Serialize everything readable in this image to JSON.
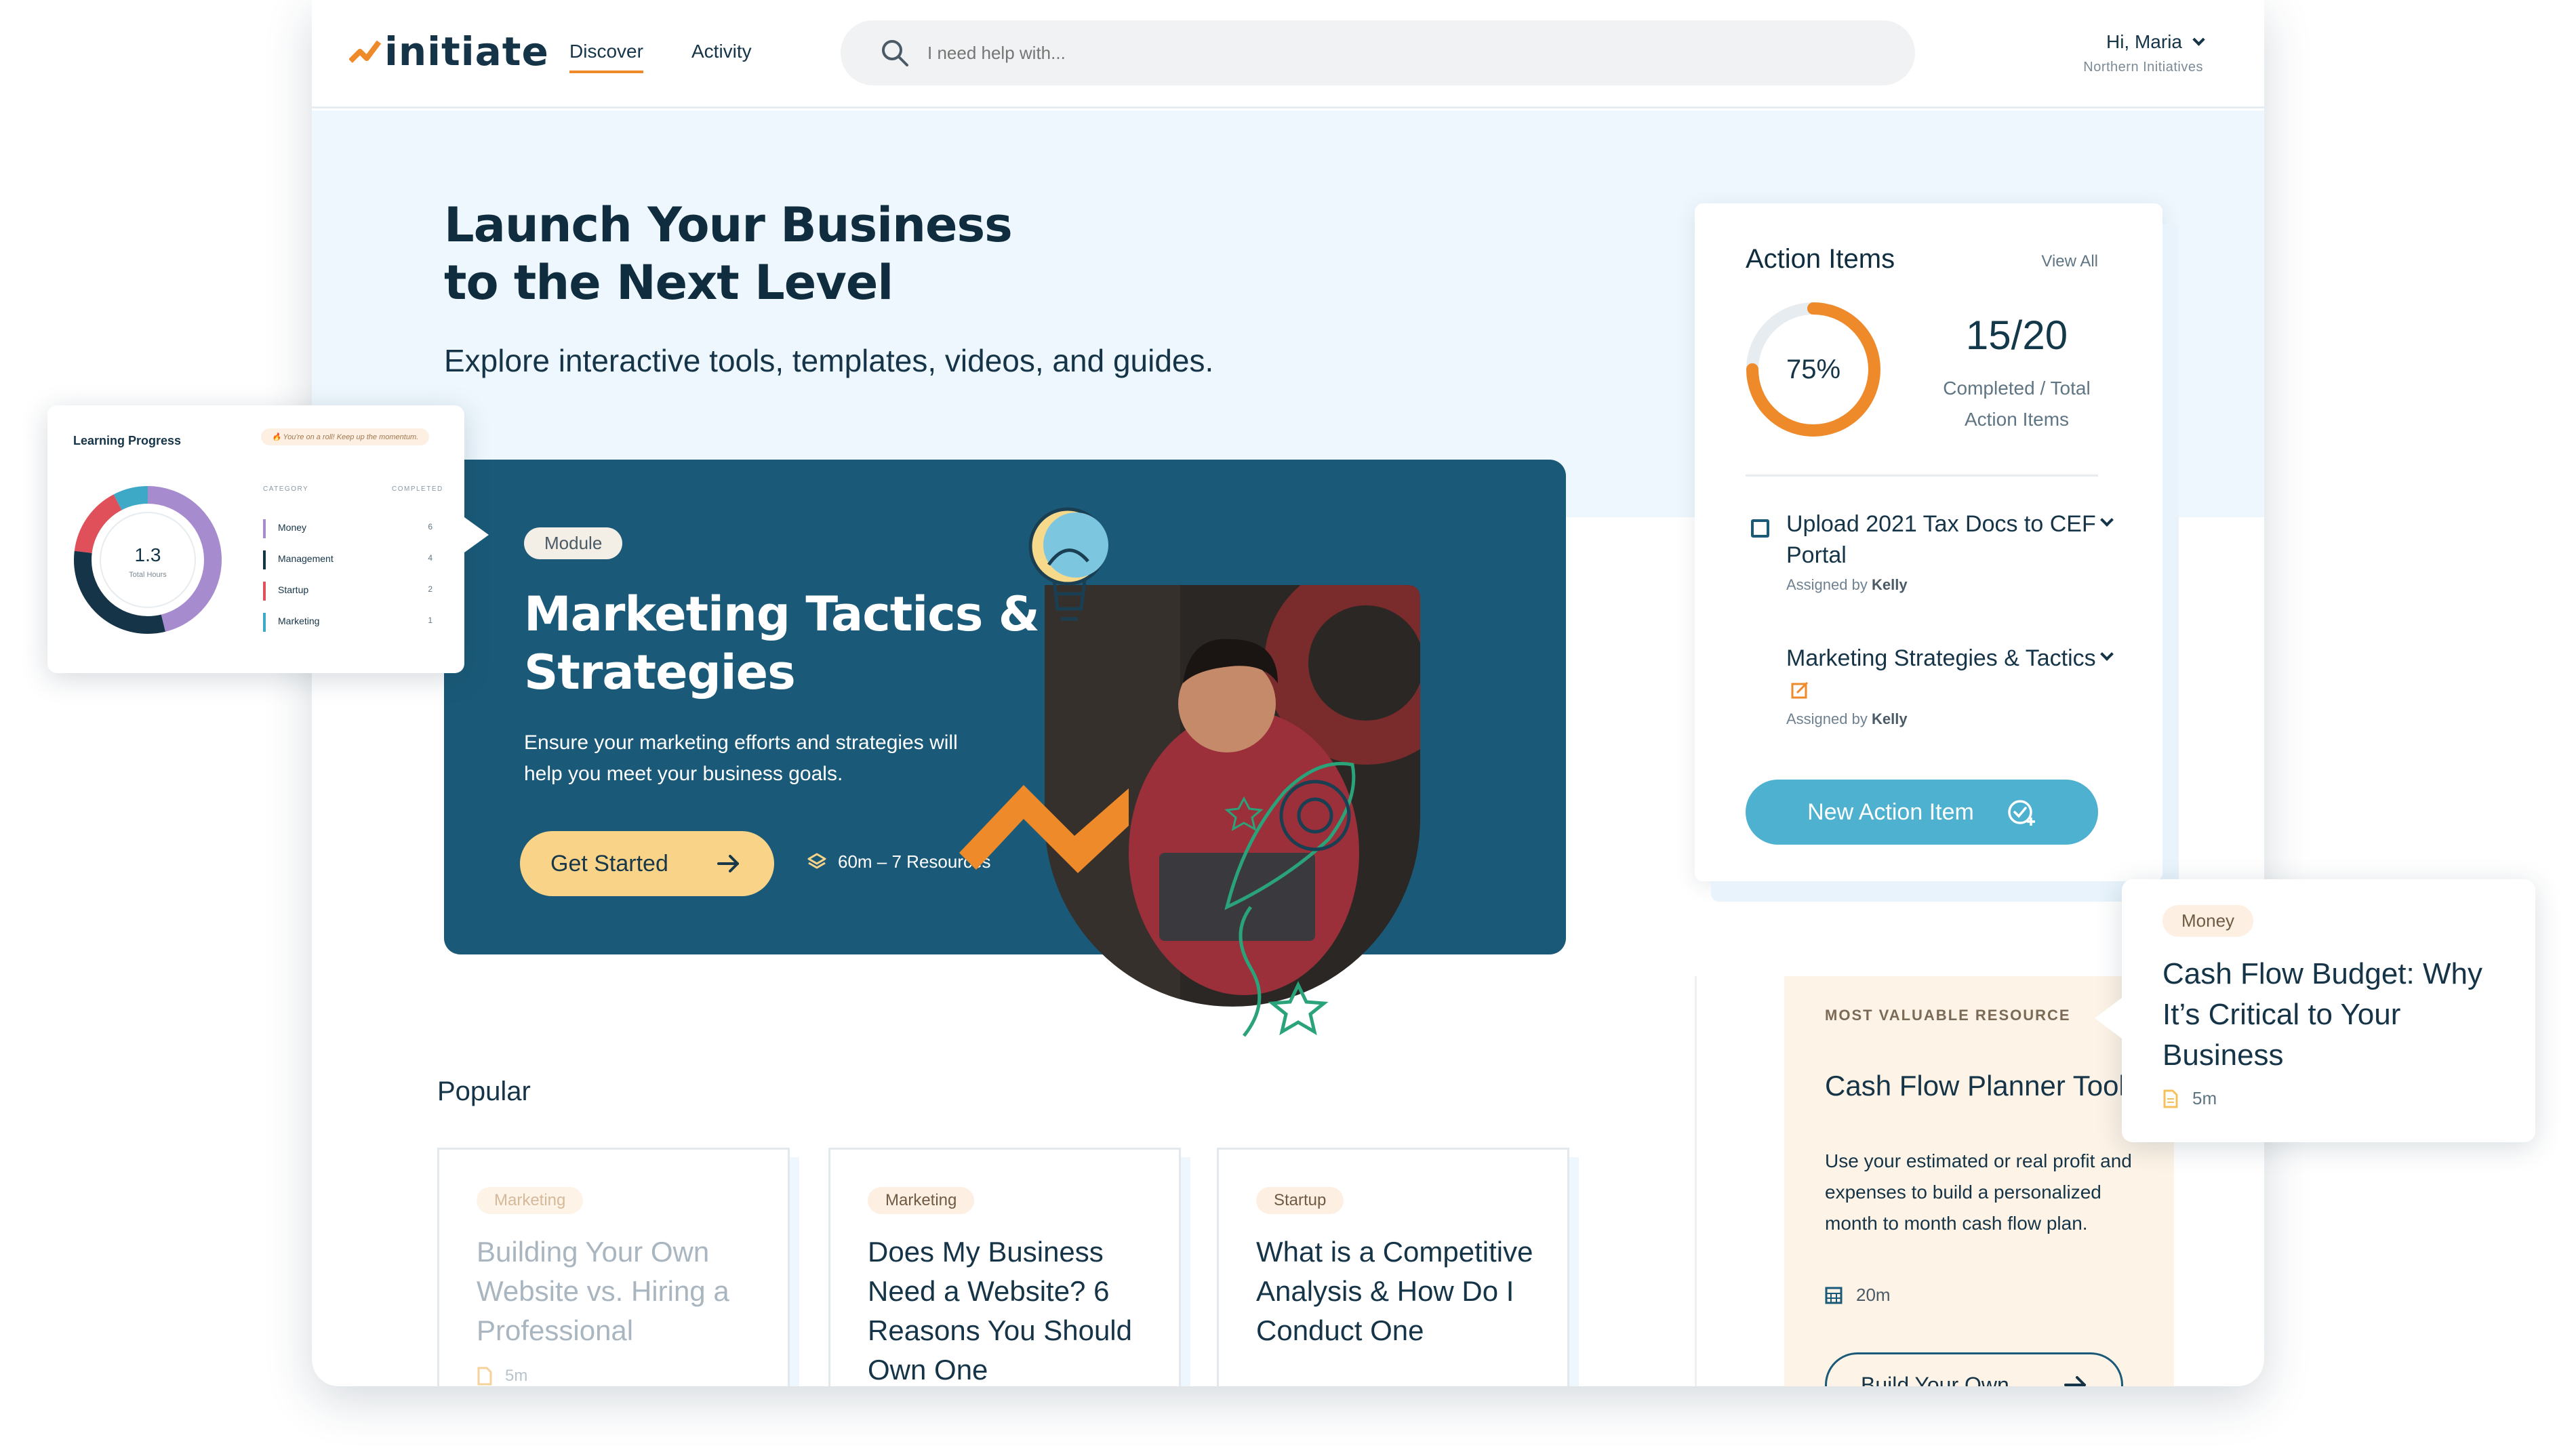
{
  "header": {
    "logo_text": "initiate",
    "nav": [
      "Discover",
      "Activity"
    ],
    "search_placeholder": "I need help with...",
    "user_greeting": "Hi, Maria",
    "user_org": "Northern Initiatives"
  },
  "hero": {
    "headline": "Launch Your Business to the Next Level",
    "subhead": "Explore interactive tools, templates, videos, and guides."
  },
  "module": {
    "badge": "Module",
    "title": "Marketing Tactics & Strategies",
    "description": "Ensure your marketing efforts and strategies will help you meet your business goals.",
    "cta": "Get Started",
    "meta": "60m – 7 Resources"
  },
  "action_items": {
    "title": "Action Items",
    "view_all": "View All",
    "percent_label": "75%",
    "percent_value": 0.75,
    "count": "15/20",
    "count_label": "Completed / Total Action Items",
    "tasks": [
      {
        "title": "Upload 2021 Tax Docs to CEF Portal",
        "assigned_prefix": "Assigned by",
        "assigned_by": "Kelly"
      },
      {
        "title": "Marketing Strategies & Tactics",
        "assigned_prefix": "Assigned by",
        "assigned_by": "Kelly"
      }
    ],
    "new_button": "New Action Item"
  },
  "popular": {
    "title": "Popular",
    "cards": [
      {
        "tag": "Marketing",
        "title": "Building Your Own Website vs. Hiring a Professional",
        "meta": "5m"
      },
      {
        "tag": "Marketing",
        "title": "Does My Business Need a Website? 6 Reasons You Should Own One"
      },
      {
        "tag": "Startup",
        "title": "What is a Competitive Analysis & How Do I Conduct One"
      }
    ]
  },
  "valuable": {
    "label": "MOST VALUABLE RESOURCE",
    "title": "Cash Flow Planner Tool",
    "description": "Use your estimated or real profit and expenses to build a personalized month to month cash flow plan.",
    "meta": "20m",
    "cta": "Build Your Own"
  },
  "learning_progress": {
    "title": "Learning Progress",
    "badge": "🔥 You're on a roll! Keep up the momentum.",
    "total_value": "1.3",
    "total_label": "Total Hours",
    "col_category": "CATEGORY",
    "col_completed": "COMPLETED",
    "rows": [
      {
        "name": "Money",
        "count": "6",
        "color": "#a78bcf"
      },
      {
        "name": "Management",
        "count": "4",
        "color": "#153447"
      },
      {
        "name": "Startup",
        "count": "2",
        "color": "#e0505a"
      },
      {
        "name": "Marketing",
        "count": "1",
        "color": "#3ea9c6"
      }
    ]
  },
  "money_card": {
    "tag": "Money",
    "title": "Cash Flow Budget: Why It’s Critical to Your Business",
    "meta": "5m"
  },
  "colors": {
    "brand_navy": "#153447",
    "accent_orange": "#ef8a2b",
    "module_bg": "#1a5a78",
    "cta_yellow": "#f9d488",
    "teal_button": "#4eb1cf",
    "hero_bg": "#eef7fd"
  }
}
